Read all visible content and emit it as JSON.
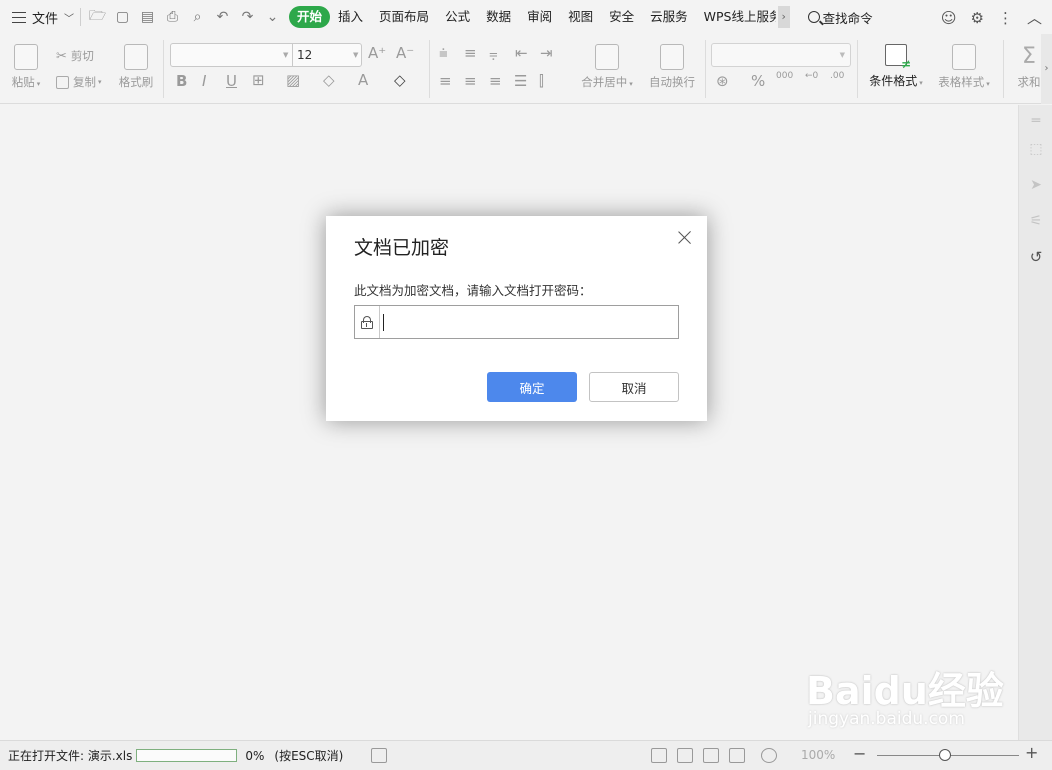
{
  "menubar": {
    "file_label": "文件",
    "tabs": [
      {
        "label": "开始",
        "active": true
      },
      {
        "label": "插入"
      },
      {
        "label": "页面布局"
      },
      {
        "label": "公式"
      },
      {
        "label": "数据"
      },
      {
        "label": "审阅"
      },
      {
        "label": "视图"
      },
      {
        "label": "安全"
      },
      {
        "label": "云服务"
      },
      {
        "label": "WPS线上服务"
      }
    ],
    "tab_more": "›",
    "search_label": "查找命令"
  },
  "ribbon": {
    "paste_label": "粘贴",
    "cut_label": "剪切",
    "copy_label": "复制",
    "format_painter_label": "格式刷",
    "font_name": "",
    "font_size": "12",
    "merge_center_label": "合并居中",
    "wrap_text_label": "自动换行",
    "number_format": "",
    "percent_symbol": "%",
    "thousands_symbol": "000",
    "conditional_format_label": "条件格式",
    "table_style_label": "表格样式",
    "sum_label": "求和"
  },
  "dialog": {
    "title": "文档已加密",
    "message": "此文档为加密文档，请输入文档打开密码：",
    "password_value": "",
    "ok_label": "确定",
    "cancel_label": "取消"
  },
  "statusbar": {
    "status_text": "正在打开文件: 演示.xls",
    "progress_percent": "0%",
    "progress_value": 0,
    "esc_hint": "(按ESC取消)",
    "zoom_label": "100%"
  },
  "watermark": {
    "brand": "Baidu经验",
    "url": "jingyan.baidu.com"
  },
  "colors": {
    "active_tab": "#2da84a",
    "primary_button": "#4d88ec",
    "progress_border": "#7fb07f"
  }
}
